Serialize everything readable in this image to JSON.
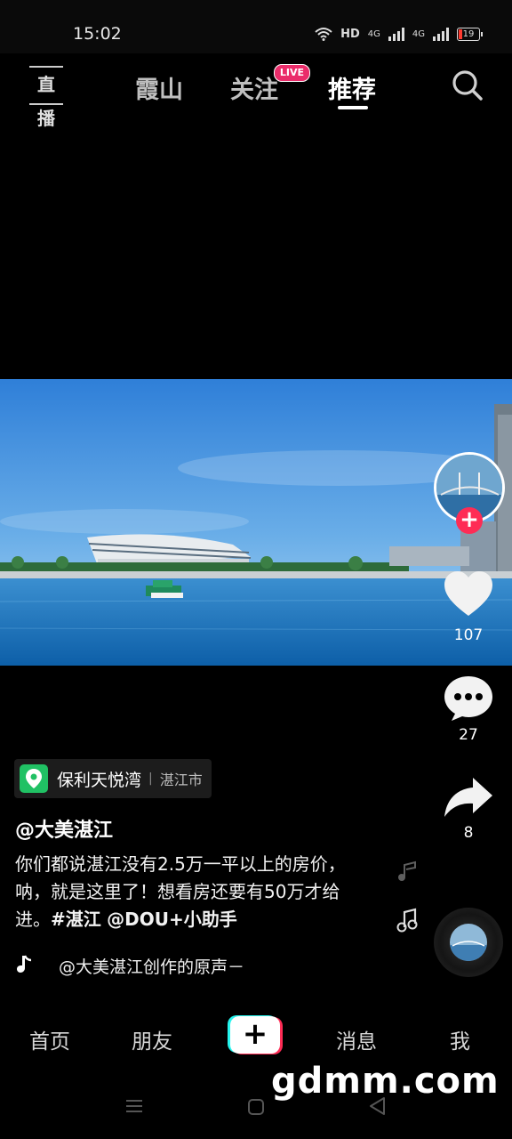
{
  "status_bar": {
    "time": "15:02",
    "hd_label": "HD",
    "net1": "4G",
    "net2": "4G",
    "battery": "19",
    "icons": [
      "wifi-icon",
      "signal-icon",
      "signal-icon",
      "battery-icon"
    ]
  },
  "top_nav": {
    "live_icon_label": "直播",
    "tabs": [
      "霞山",
      "关注",
      "推荐"
    ],
    "active_tab": "推荐",
    "live_badge": "LIVE",
    "search_icon": "search-icon"
  },
  "rail": {
    "like_count": "107",
    "comment_count": "27",
    "share_count": "8",
    "follow_label": "+"
  },
  "caption": {
    "poi_name": "保利天悦湾",
    "poi_sep": "|",
    "poi_city": "湛江市",
    "author": "@大美湛江",
    "desc_text": "你们都说湛江没有2.5万一平以上的房价，呐，就是这里了！想看房还要有50万才给进。",
    "desc_tag": "#湛江",
    "desc_mention": "@DOU+小助手",
    "music_icon": "♪",
    "music_text": "@大美湛江创作的原声－"
  },
  "bottom_nav": {
    "items": [
      "首页",
      "朋友",
      "消息",
      "我"
    ],
    "create_label": "+"
  },
  "watermark": "gdmm.com",
  "colors": {
    "accent": "#fe2c55",
    "accent_cyan": "#25f4ee",
    "live_badge": "#ea2c6a",
    "poi_green": "#20c164"
  }
}
